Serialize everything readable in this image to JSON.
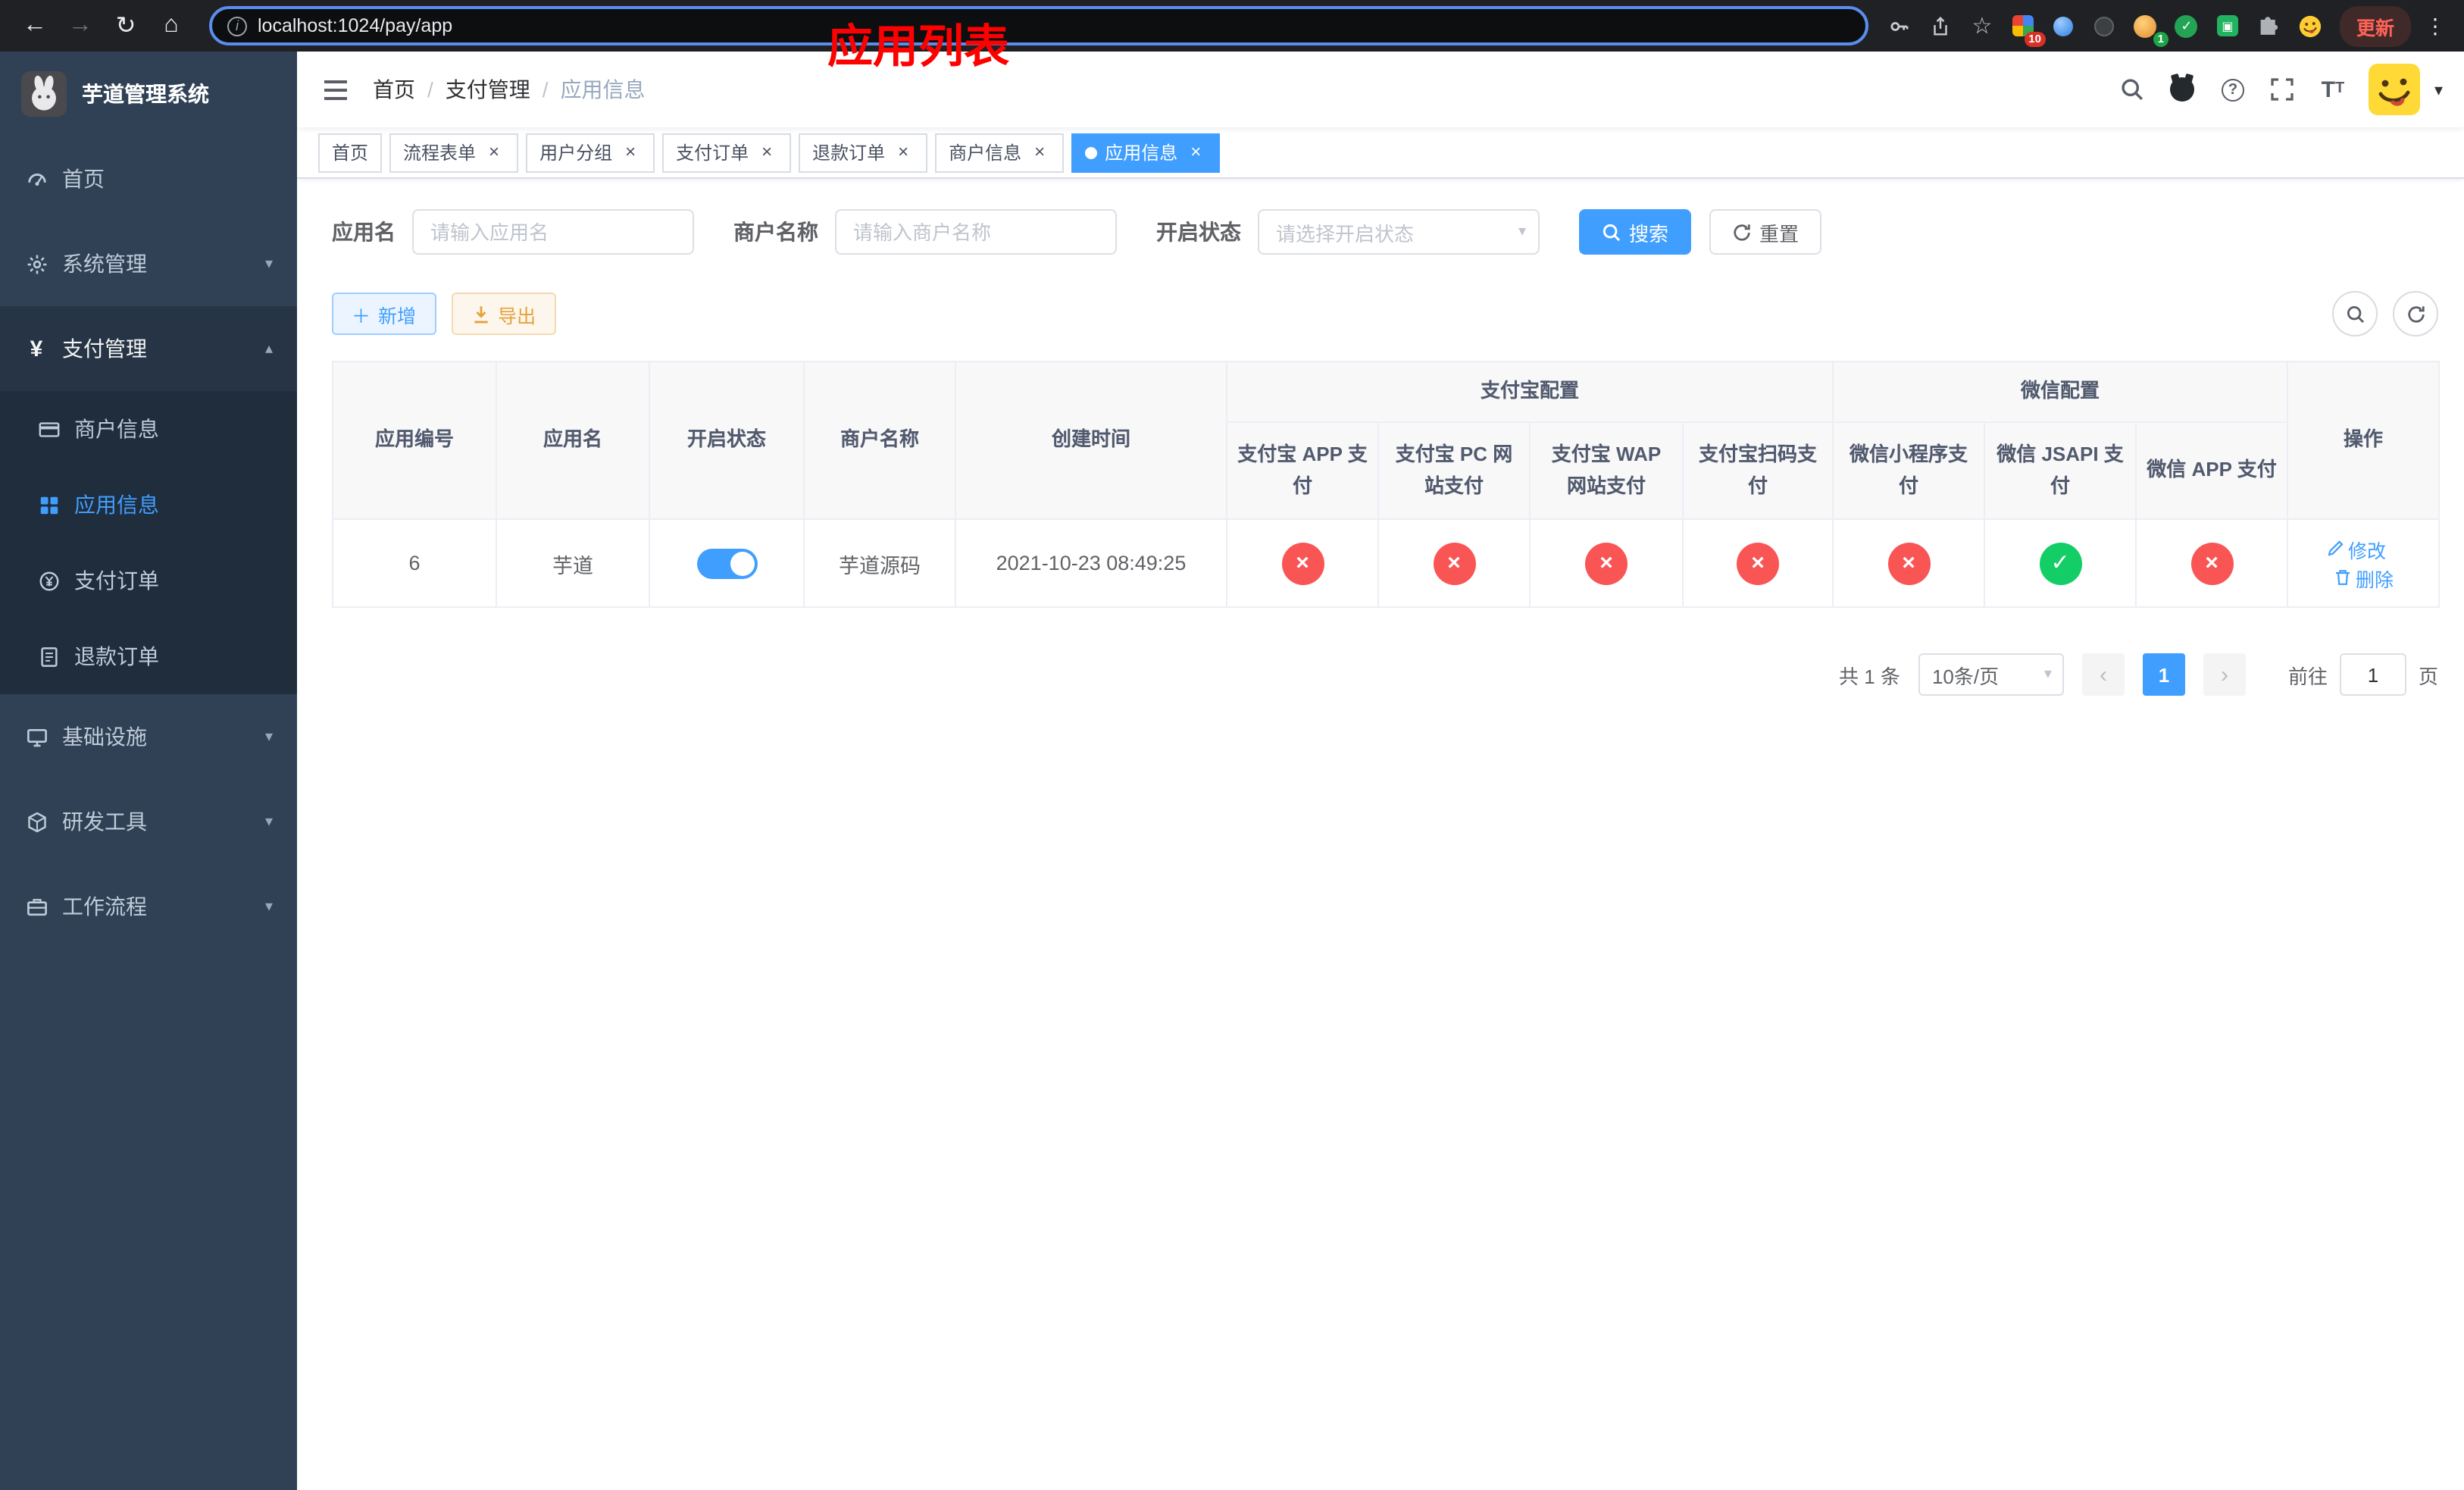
{
  "browser": {
    "url": "localhost:1024/pay/app",
    "update_button": "更新",
    "extension_badge_grid": "10",
    "extension_badge_avatar": "1"
  },
  "sidebar": {
    "logo_title": "芋道管理系统",
    "items": [
      {
        "icon": "dashboard-icon",
        "label": "首页"
      },
      {
        "icon": "gear-icon",
        "label": "系统管理",
        "chevron": "down"
      },
      {
        "icon": "yen-icon",
        "label": "支付管理",
        "chevron": "up",
        "open": true,
        "children": [
          {
            "icon": "bankcard-icon",
            "label": "商户信息"
          },
          {
            "icon": "grid-icon",
            "label": "应用信息",
            "active": true
          },
          {
            "icon": "pay-order-icon",
            "label": "支付订单"
          },
          {
            "icon": "refund-order-icon",
            "label": "退款订单"
          }
        ]
      },
      {
        "icon": "infra-icon",
        "label": "基础设施",
        "chevron": "down"
      },
      {
        "icon": "devtool-icon",
        "label": "研发工具",
        "chevron": "down"
      },
      {
        "icon": "workflow-icon",
        "label": "工作流程",
        "chevron": "down"
      }
    ]
  },
  "navbar": {
    "breadcrumb": [
      "首页",
      "支付管理",
      "应用信息"
    ],
    "page_title": "应用列表"
  },
  "tabs": [
    {
      "label": "首页",
      "closable": false,
      "active": false
    },
    {
      "label": "流程表单",
      "closable": true,
      "active": false
    },
    {
      "label": "用户分组",
      "closable": true,
      "active": false
    },
    {
      "label": "支付订单",
      "closable": true,
      "active": false
    },
    {
      "label": "退款订单",
      "closable": true,
      "active": false
    },
    {
      "label": "商户信息",
      "closable": true,
      "active": false
    },
    {
      "label": "应用信息",
      "closable": true,
      "active": true
    }
  ],
  "filters": {
    "app_name_label": "应用名",
    "app_name_placeholder": "请输入应用名",
    "merchant_label": "商户名称",
    "merchant_placeholder": "请输入商户名称",
    "status_label": "开启状态",
    "status_placeholder": "请选择开启状态",
    "search_button": "搜索",
    "reset_button": "重置"
  },
  "toolbar": {
    "add_button": "新增",
    "export_button": "导出"
  },
  "table": {
    "header": {
      "simple": [
        "应用编号",
        "应用名",
        "开启状态",
        "商户名称",
        "创建时间"
      ],
      "groups": [
        {
          "label": "支付宝配置",
          "children": [
            "支付宝 APP 支付",
            "支付宝 PC 网站支付",
            "支付宝 WAP 网站支付",
            "支付宝扫码支付"
          ]
        },
        {
          "label": "微信配置",
          "children": [
            "微信小程序支付",
            "微信 JSAPI 支付",
            "微信 APP 支付"
          ]
        }
      ],
      "action": "操作"
    },
    "rows": [
      {
        "id": "6",
        "name": "芋道",
        "enabled": true,
        "merchant": "芋道源码",
        "created": "2021-10-23 08:49:25",
        "statuses": [
          "fail",
          "fail",
          "fail",
          "fail",
          "fail",
          "success",
          "fail"
        ],
        "edit_label": "修改",
        "delete_label": "删除"
      }
    ]
  },
  "pagination": {
    "total": "共 1 条",
    "page_size": "10条/页",
    "current_page": "1",
    "goto_prefix": "前往",
    "goto_value": "1",
    "goto_suffix": "页"
  },
  "colors": {
    "accent": "#409eff",
    "success": "#13ce66",
    "danger": "#fa5555",
    "warning": "#e6a23c",
    "page_title_red": "#ff0000",
    "sidebar_bg": "#304156",
    "submenu_bg": "#1f2d3d"
  }
}
